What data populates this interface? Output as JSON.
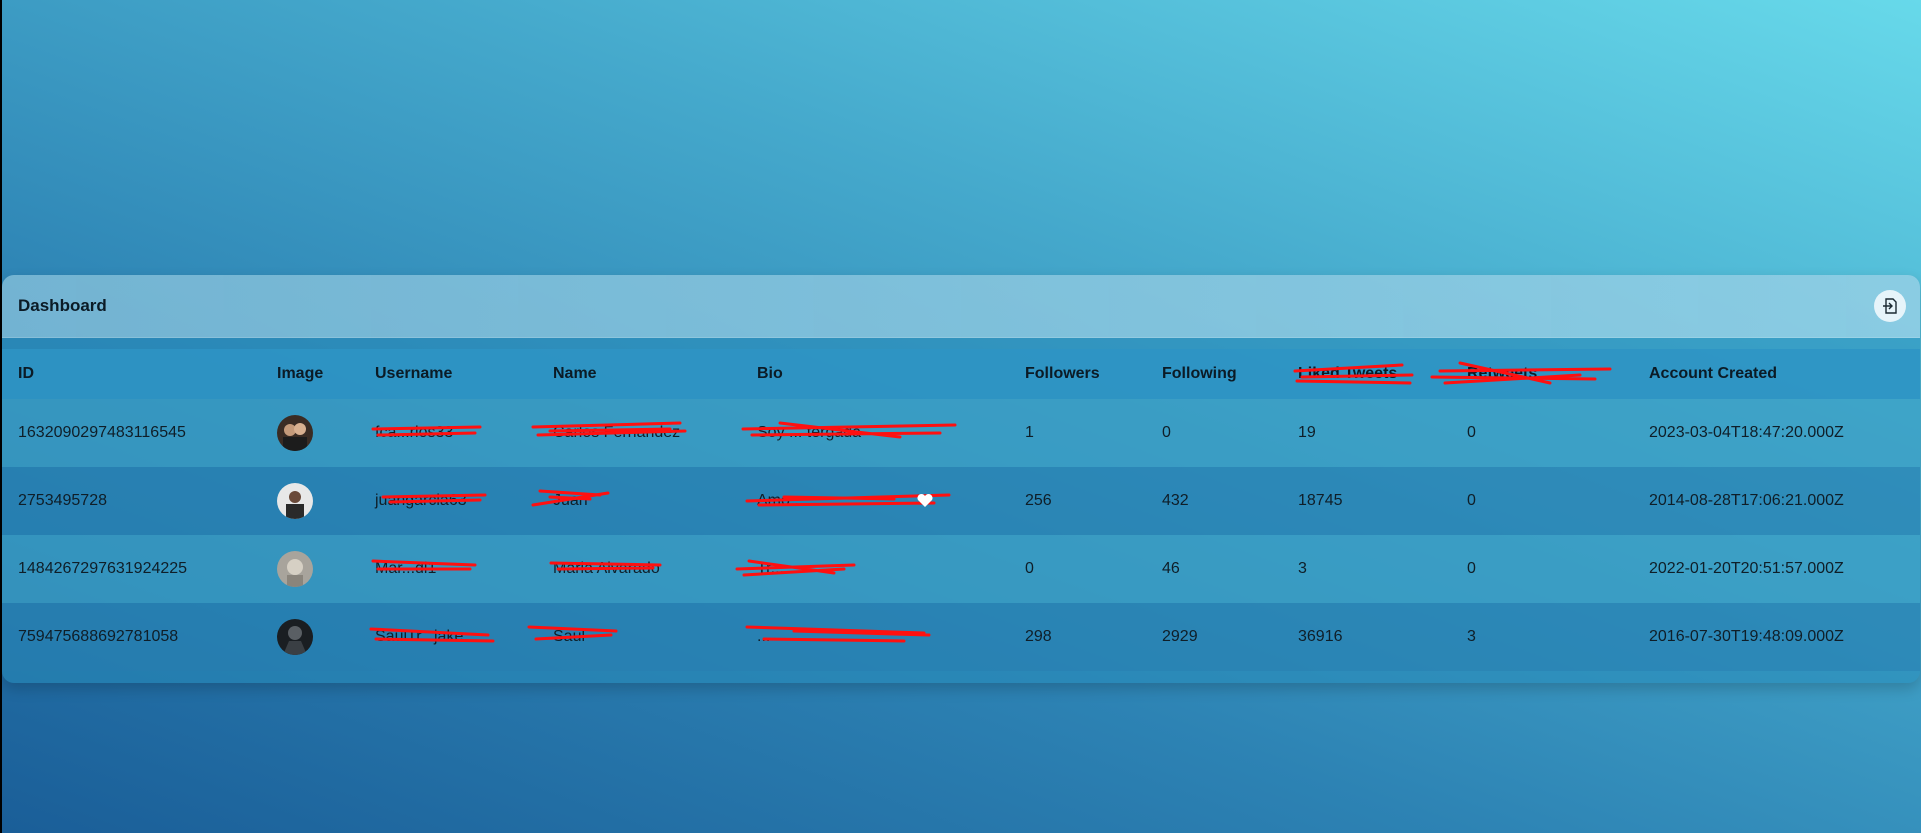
{
  "dashboard": {
    "title": "Dashboard",
    "logout_icon": "logout-icon"
  },
  "table": {
    "headers": {
      "id": "ID",
      "image": "Image",
      "username": "Username",
      "name": "Name",
      "bio": "Bio",
      "followers": "Followers",
      "following": "Following",
      "liked_tweets": "Liked Tweets",
      "retweets": "Retweets",
      "account_created": "Account Created"
    },
    "rows": [
      {
        "id": "1632090297483116545",
        "avatar_icon": "user-avatar",
        "username": "fca...rlos33",
        "name": "Carlos Fernandez",
        "bio": "Soy ... tergada",
        "followers": "1",
        "following": "0",
        "liked_tweets": "19",
        "retweets": "0",
        "account_created": "2023-03-04T18:47:20.000Z"
      },
      {
        "id": "2753495728",
        "avatar_icon": "user-avatar",
        "username": "juangarcia63",
        "name": "Juan",
        "bio": "Amo ... ",
        "followers": "256",
        "following": "432",
        "liked_tweets": "18745",
        "retweets": "0",
        "account_created": "2014-08-28T17:06:21.000Z"
      },
      {
        "id": "1484267297631924225",
        "avatar_icon": "user-avatar",
        "username": "Mar...di1",
        "name": "Maria Alvarado",
        "bio": "Tr...",
        "followers": "0",
        "following": "46",
        "liked_tweets": "3",
        "retweets": "0",
        "account_created": "2022-01-20T20:51:57.000Z"
      },
      {
        "id": "759475688692781058",
        "avatar_icon": "user-avatar",
        "username": "SaulTr...jake",
        "name": "Saul",
        "bio": "...",
        "followers": "298",
        "following": "2929",
        "liked_tweets": "36916",
        "retweets": "3",
        "account_created": "2016-07-30T19:48:09.000Z"
      }
    ]
  },
  "colors": {
    "redaction": "#ff1010",
    "header_bg": "#2e94c4",
    "text": "#0f1e28"
  }
}
